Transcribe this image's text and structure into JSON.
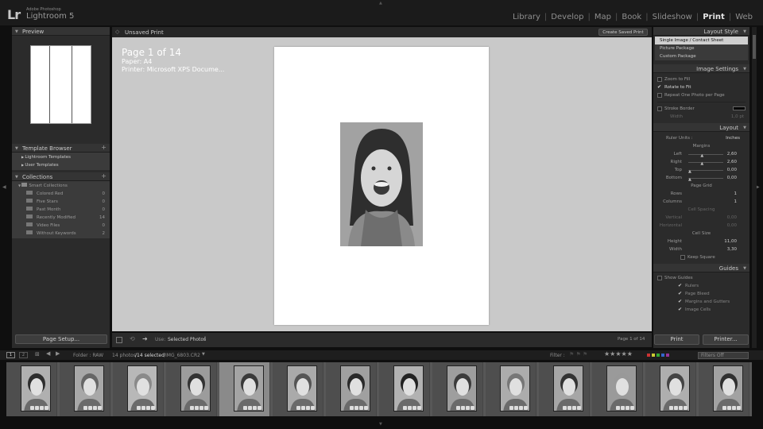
{
  "app": {
    "logo": "Lr",
    "adobe": "Adobe Photoshop",
    "name": "Lightroom 5"
  },
  "modules": [
    {
      "label": "Library"
    },
    {
      "label": "Develop"
    },
    {
      "label": "Map"
    },
    {
      "label": "Book"
    },
    {
      "label": "Slideshow"
    },
    {
      "label": "Print",
      "active": true
    },
    {
      "label": "Web"
    }
  ],
  "left": {
    "preview_title": "Preview",
    "template_browser_title": "Template Browser",
    "templates": [
      "Lightroom Templates",
      "User Templates"
    ],
    "collections_title": "Collections",
    "smart_collections": "Smart Collections",
    "collections": [
      {
        "name": "Colored Red",
        "count": "0"
      },
      {
        "name": "Five Stars",
        "count": "0"
      },
      {
        "name": "Past Month",
        "count": "0"
      },
      {
        "name": "Recently Modified",
        "count": "14"
      },
      {
        "name": "Video Files",
        "count": "0"
      },
      {
        "name": "Without Keywords",
        "count": "2"
      }
    ],
    "page_setup": "Page Setup..."
  },
  "center": {
    "tab": "Unsaved Print",
    "create_saved": "Create Saved Print",
    "page_info": "Page 1 of 14",
    "paper": "Paper:  A4",
    "printer": "Printer:  Microsoft XPS Docume...",
    "use_label": "Use:",
    "use_value": "Selected Photos",
    "page_count": "Page 1 of 14"
  },
  "right": {
    "layout_style_title": "Layout Style",
    "layout_styles": [
      "Single Image / Contact Sheet",
      "Picture Package",
      "Custom Package"
    ],
    "image_settings_title": "Image Settings",
    "zoom_to_fill": "Zoom to Fill",
    "rotate_to_fit": "Rotate to Fit",
    "repeat_one": "Repeat One Photo per Page",
    "stroke_border": "Stroke Border",
    "width_label": "Width",
    "stroke_width": "1,0 pt",
    "layout_title": "Layout",
    "ruler_units_label": "Ruler Units :",
    "ruler_units": "Inches",
    "margins_label": "Margins",
    "margins": [
      {
        "name": "Left",
        "value": "2,60"
      },
      {
        "name": "Right",
        "value": "2,60"
      },
      {
        "name": "Top",
        "value": "0,00"
      },
      {
        "name": "Bottom",
        "value": "0,00"
      }
    ],
    "page_grid_label": "Page Grid",
    "rows_label": "Rows",
    "rows": "1",
    "columns_label": "Columns",
    "columns": "1",
    "cell_spacing_label": "Cell Spacing",
    "vertical_label": "Vertical",
    "vertical": "0,00",
    "horizontal_label": "Horizontal",
    "horizontal": "0,00",
    "cell_size_label": "Cell Size",
    "height_label": "Height",
    "height": "11,00",
    "width_cell_label": "Width",
    "width_cell": "3,30",
    "keep_square": "Keep Square",
    "guides_title": "Guides",
    "show_guides": "Show Guides",
    "guides": [
      "Rulers",
      "Page Bleed",
      "Margins and Gutters",
      "Image Cells"
    ],
    "print_btn": "Print",
    "printer_btn": "Printer..."
  },
  "filmstrip": {
    "page1": "1",
    "page2": "2",
    "folder": "Folder : RAW",
    "photo_count": "14 photos",
    "selected": "/14 selected",
    "filename": "/IMG_6803.CR2",
    "filter_label": "Filter :",
    "filters_off": "Filters Off",
    "thumbs": 14,
    "selected_index": 4
  },
  "colors": {
    "accent": "#e4e4e4",
    "panel": "#2b2b2b",
    "canvas": "#c9c9c9"
  }
}
